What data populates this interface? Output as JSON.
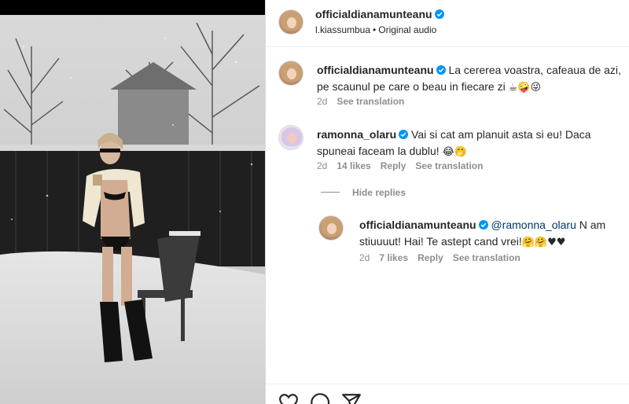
{
  "post": {
    "author": "officialdianamunteanu",
    "audio_user": "l.kiassumbua",
    "audio_sep": "•",
    "audio_label": "Original audio"
  },
  "comments": [
    {
      "username": "officialdianamunteanu",
      "text": "La cererea voastra, cafeaua de azi, pe scaunul pe care o beau in fiecare zi",
      "emojis": "☕🤪😜",
      "time": "2d",
      "see_translation": "See translation"
    },
    {
      "username": "ramonna_olaru",
      "text": "Vai si cat am planuit asta si eu! Daca spuneai faceam la dublu!",
      "emojis": "😂🤭",
      "time": "2d",
      "likes": "14 likes",
      "reply": "Reply",
      "see_translation": "See translation"
    }
  ],
  "hide_replies": "Hide replies",
  "reply": {
    "username": "officialdianamunteanu",
    "mention": "@ramonna_olaru",
    "text": "N am stiuuuut! Hai! Te astept cand vrei!",
    "emojis": "🤗🤗♥♥",
    "time": "2d",
    "likes": "7 likes",
    "reply": "Reply",
    "see_translation": "See translation"
  },
  "icons": [
    "verified-badge-icon",
    "heart-icon",
    "comment-icon",
    "share-icon"
  ],
  "colors": {
    "verified": "#0095f6",
    "meta": "#8e8e8e",
    "mention": "#00376b"
  }
}
